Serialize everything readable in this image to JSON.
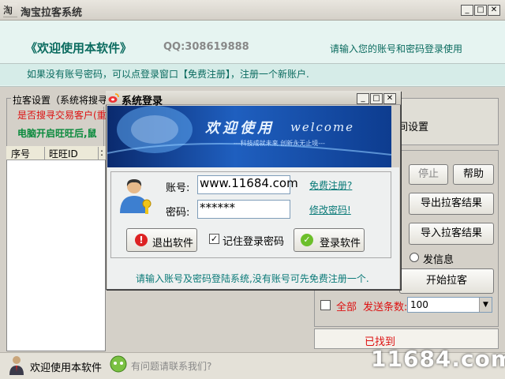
{
  "window": {
    "title": "淘宝拉客系统",
    "icon_text": "淘"
  },
  "banner": {
    "welcome": "《欢迎使用本软件》",
    "qq": "QQ:308619888",
    "login_hint": "请输入您的账号和密码登录使用",
    "register_hint": "如果没有账号密码，可以点登录窗口【免费注册】，注册一个新账户."
  },
  "settings": {
    "group_label": "拉客设置（系统将搜寻",
    "question": "是否搜寻交易客户(重",
    "wangwang": "电脑开启旺旺后,鼠"
  },
  "table": {
    "columns": [
      "序号",
      "旺旺ID",
      ":"
    ]
  },
  "right_panel": {
    "time_setting": "间设置",
    "stop_button": "停止",
    "help_button": "帮助",
    "export_button": "导出拉客结果",
    "import_button": "导入拉客结果",
    "send_info_label": "发信息",
    "start_button": "开始拉客",
    "all_label": "全部",
    "send_count_label": "发送条数:",
    "send_count_value": "100",
    "found_text": "已找到"
  },
  "statusbar": {
    "welcome": "欢迎使用本软件",
    "question": "有问题请联系我们?"
  },
  "dialog": {
    "title": "系统登录",
    "banner_text": "欢迎使用",
    "banner_welcome": "welcome",
    "banner_slogan": "---科技成就未来   创新永无止境---",
    "account_label": "账号:",
    "account_value": "www.11684.com",
    "password_label": "密码:",
    "password_value": "******",
    "register_link": "免费注册?",
    "change_password_link": "修改密码!",
    "exit_button": "退出软件",
    "remember_label": "记住登录密码",
    "login_button": "登录软件",
    "footer_hint": "请输入账号及密码登陆系统,没有账号可先免费注册一个."
  },
  "watermark": "11684.com"
}
